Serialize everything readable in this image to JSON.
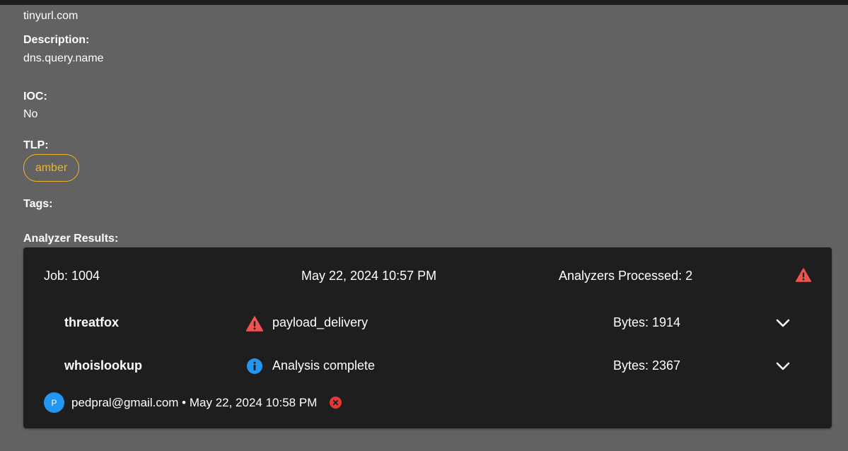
{
  "observable": {
    "value": "tinyurl.com",
    "description_label": "Description:",
    "description": "dns.query.name",
    "ioc_label": "IOC:",
    "ioc": "No",
    "tlp_label": "TLP:",
    "tlp": "amber",
    "tags_label": "Tags:",
    "analyzer_results_label": "Analyzer Results:"
  },
  "job": {
    "id_text": "Job: 1004",
    "date": "May 22, 2024 10:57 PM",
    "processed_text": "Analyzers Processed: 2",
    "status_icon": "warning-icon",
    "analyzers": [
      {
        "name": "threatfox",
        "icon": "warning-icon",
        "summary": "payload_delivery",
        "bytes": "Bytes: 1914"
      },
      {
        "name": "whoislookup",
        "icon": "info-icon",
        "summary": "Analysis complete",
        "bytes": "Bytes: 2367"
      }
    ],
    "user": {
      "avatar_initial": "P",
      "email": "pedpral@gmail.com",
      "separator": "•",
      "date": "May 22, 2024 10:58 PM"
    }
  },
  "colors": {
    "background": "#626262",
    "card": "#1e1e1e",
    "tlp_amber": "#f0b429",
    "warning": "#ef5350",
    "info": "#2196f3",
    "delete": "#e53935"
  }
}
